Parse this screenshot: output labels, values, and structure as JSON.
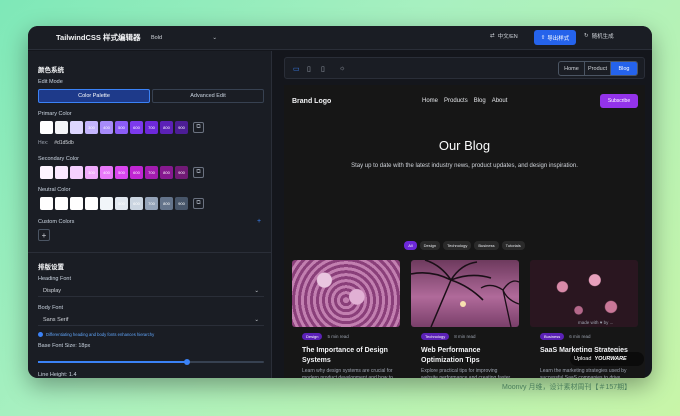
{
  "app": {
    "title": "TailwindCSS 样式编辑器",
    "style_select": "Bold",
    "lang": "中文/EN",
    "export": "导出样式",
    "random": "随机生成"
  },
  "sidebar": {
    "colors_title": "颜色系统",
    "edit_mode_label": "Edit Mode",
    "mode_palette": "Color Palette",
    "mode_advanced": "Advanced Edit",
    "primary_label": "Primary Color",
    "hex_label": "Hex:",
    "hex_value": "#d1d5db",
    "secondary_label": "Secondary Color",
    "neutral_label": "Neutral Color",
    "custom_label": "Custom Colors",
    "typography_title": "排版设置",
    "heading_font_label": "Heading Font",
    "heading_font_value": "Display",
    "body_font_label": "Body Font",
    "body_font_value": "Sans Serif",
    "font_hint": "Differentiating heading and body fonts enhances hierarchy",
    "base_font_label": "Base Font Size: 18px",
    "base_font_level": 0.66,
    "line_height_label": "Line Height: 1.4",
    "primary": [
      "#ffffff",
      "#f3f4f6",
      "#ddd6fe",
      "#c4b5fd",
      "#a78bfa",
      "#8b5cf6",
      "#7c3aed",
      "#6d28d9",
      "#5b21b6",
      "#4c1d95"
    ],
    "primary_labels": [
      "",
      "",
      "",
      "300",
      "400",
      "500",
      "600",
      "700",
      "800",
      "900"
    ],
    "secondary": [
      "#fdf4ff",
      "#fae8ff",
      "#f5d0fe",
      "#f0abfc",
      "#e879f9",
      "#d946ef",
      "#c026d3",
      "#a21caf",
      "#86198f",
      "#701a75"
    ],
    "secondary_labels": [
      "",
      "",
      "",
      "300",
      "400",
      "500",
      "600",
      "700",
      "800",
      "900"
    ],
    "neutral": [
      "#ffffff",
      "#ffffff",
      "#ffffff",
      "#ffffff",
      "#f1f5f9",
      "#e2e8f0",
      "#cbd5e1",
      "#94a3b8",
      "#64748b",
      "#475569"
    ],
    "neutral_labels": [
      "",
      "",
      "",
      "",
      "",
      "500",
      "600",
      "700",
      "800",
      "900"
    ]
  },
  "preview": {
    "seg_home": "Home",
    "seg_product": "Product",
    "seg_blog": "Blog"
  },
  "site": {
    "logo": "Brand Logo",
    "nav": [
      "Home",
      "Products",
      "Blog",
      "About"
    ],
    "subscribe": "Subscribe",
    "title": "Our Blog",
    "subtitle": "Stay up to date with the latest industry news, product updates, and design inspiration.",
    "tags": [
      "All",
      "Design",
      "Technology",
      "Business",
      "Tutorials"
    ],
    "cards": [
      {
        "cat": "Design",
        "read": "5 min read",
        "title": "The Importance of Design Systems",
        "text": "Learn why design systems are crucial for modern product development and how to build an effective one."
      },
      {
        "cat": "Technology",
        "read": "8 min read",
        "title": "Web Performance Optimization Tips",
        "text": "Explore practical tips for improving website performance and creating faster, more efficient web applications."
      },
      {
        "cat": "Business",
        "read": "6 min read",
        "title": "SaaS Marketing Strategies",
        "text": "Learn the marketing strategies used by successful SaaS companies to drive growth and higher conversion rates."
      }
    ]
  },
  "overlay": {
    "made_with": "made with ♥ by ...",
    "upload": "Upload",
    "brand": "YOURWARE"
  },
  "credit": "Moonvy 月维，设计素材周刊【＃157期】"
}
